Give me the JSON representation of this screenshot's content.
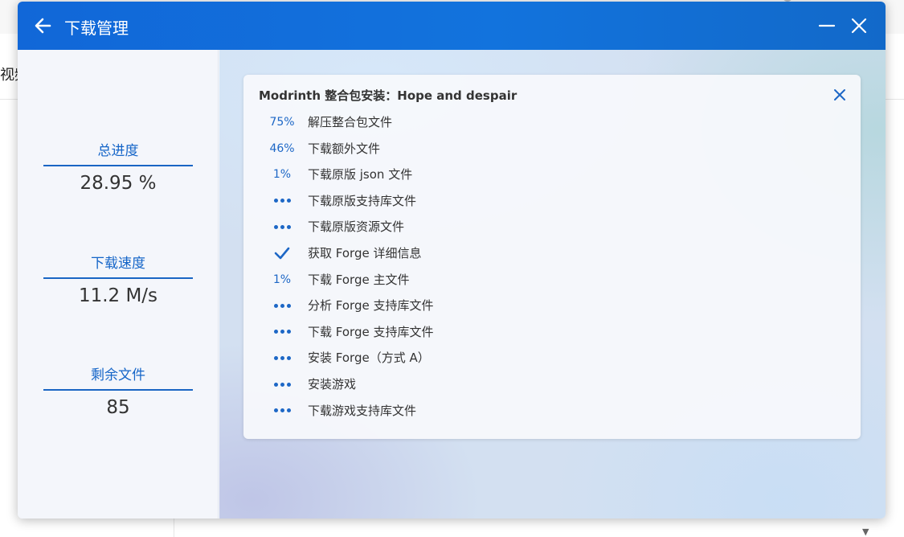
{
  "background": {
    "partial_text": "视频"
  },
  "dialog": {
    "title": "下载管理",
    "accent_color": "#1273dd"
  },
  "sidebar": {
    "stats": [
      {
        "label": "总进度",
        "value": "28.95 %"
      },
      {
        "label": "下载速度",
        "value": "11.2 M/s"
      },
      {
        "label": "剩余文件",
        "value": "85"
      }
    ]
  },
  "card": {
    "title": "Modrinth 整合包安装：Hope and despair",
    "tasks": [
      {
        "status_type": "percent",
        "status": "75%",
        "name": "解压整合包文件"
      },
      {
        "status_type": "percent",
        "status": "46%",
        "name": "下载额外文件"
      },
      {
        "status_type": "percent",
        "status": "1%",
        "name": "下载原版 json 文件"
      },
      {
        "status_type": "waiting",
        "status": "",
        "name": "下载原版支持库文件"
      },
      {
        "status_type": "waiting",
        "status": "",
        "name": "下载原版资源文件"
      },
      {
        "status_type": "done",
        "status": "",
        "name": "获取 Forge 详细信息"
      },
      {
        "status_type": "percent",
        "status": "1%",
        "name": "下载 Forge 主文件"
      },
      {
        "status_type": "waiting",
        "status": "",
        "name": "分析 Forge 支持库文件"
      },
      {
        "status_type": "waiting",
        "status": "",
        "name": "下载 Forge 支持库文件"
      },
      {
        "status_type": "waiting",
        "status": "",
        "name": "安装 Forge（方式 A）"
      },
      {
        "status_type": "waiting",
        "status": "",
        "name": "安装游戏"
      },
      {
        "status_type": "waiting",
        "status": "",
        "name": "下载游戏支持库文件"
      }
    ]
  },
  "icons": {
    "back": "arrow-left-icon",
    "minimize": "minimize-icon",
    "close": "close-icon",
    "card_close": "close-icon",
    "done": "checkmark-icon",
    "waiting": "ellipsis-icon"
  }
}
